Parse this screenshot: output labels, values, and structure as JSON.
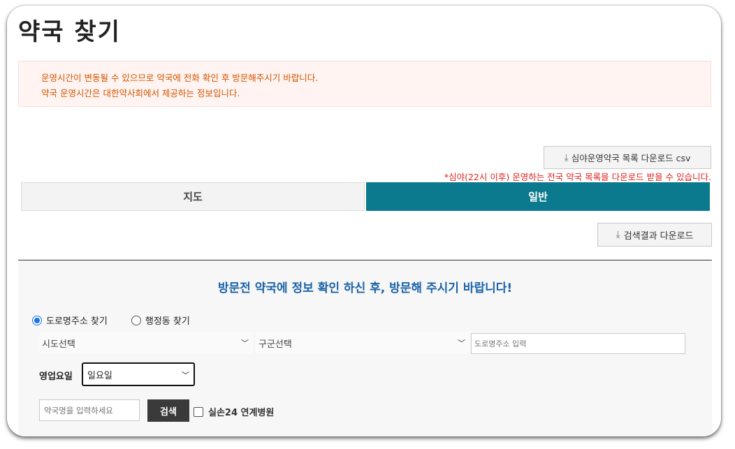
{
  "page": {
    "title": "약국 찾기"
  },
  "notice": {
    "line1": "운영시간이 변동될 수 있으므로 약국에 전화 확인 후 방문해주시기 바랍니다.",
    "line2": "약국 운영시간은 대한약사회에서 제공하는 정보입니다."
  },
  "csv": {
    "button_label": "심야운영약국 목록 다운로드 csv",
    "note": "*심야(22시 이후) 운영하는 전국 약국 목록을 다운로드 받을 수 있습니다."
  },
  "tabs": [
    {
      "label": "지도",
      "active": false
    },
    {
      "label": "일반",
      "active": true
    }
  ],
  "results": {
    "download_label": "검색결과 다운로드"
  },
  "search": {
    "heading": "방문전 약국에 정보 확인 하신 후, 방문해 주시기 바랍니다!",
    "radio_road": "도로명주소 찾기",
    "radio_admin": "행정동 찾기",
    "sido_value": "시도선택",
    "gugun_value": "구군선택",
    "road_placeholder": "도로명주소 입력",
    "day_label": "영업요일",
    "day_value": "일요일",
    "name_placeholder": "약국명을 입력하세요",
    "search_label": "검색",
    "check_label": "실손24 연계병원"
  },
  "colors": {
    "accent_tab": "#0b7a8e",
    "notice_text": "#d35400",
    "note_text": "#e0211f",
    "heading_text": "#1b63a8"
  }
}
